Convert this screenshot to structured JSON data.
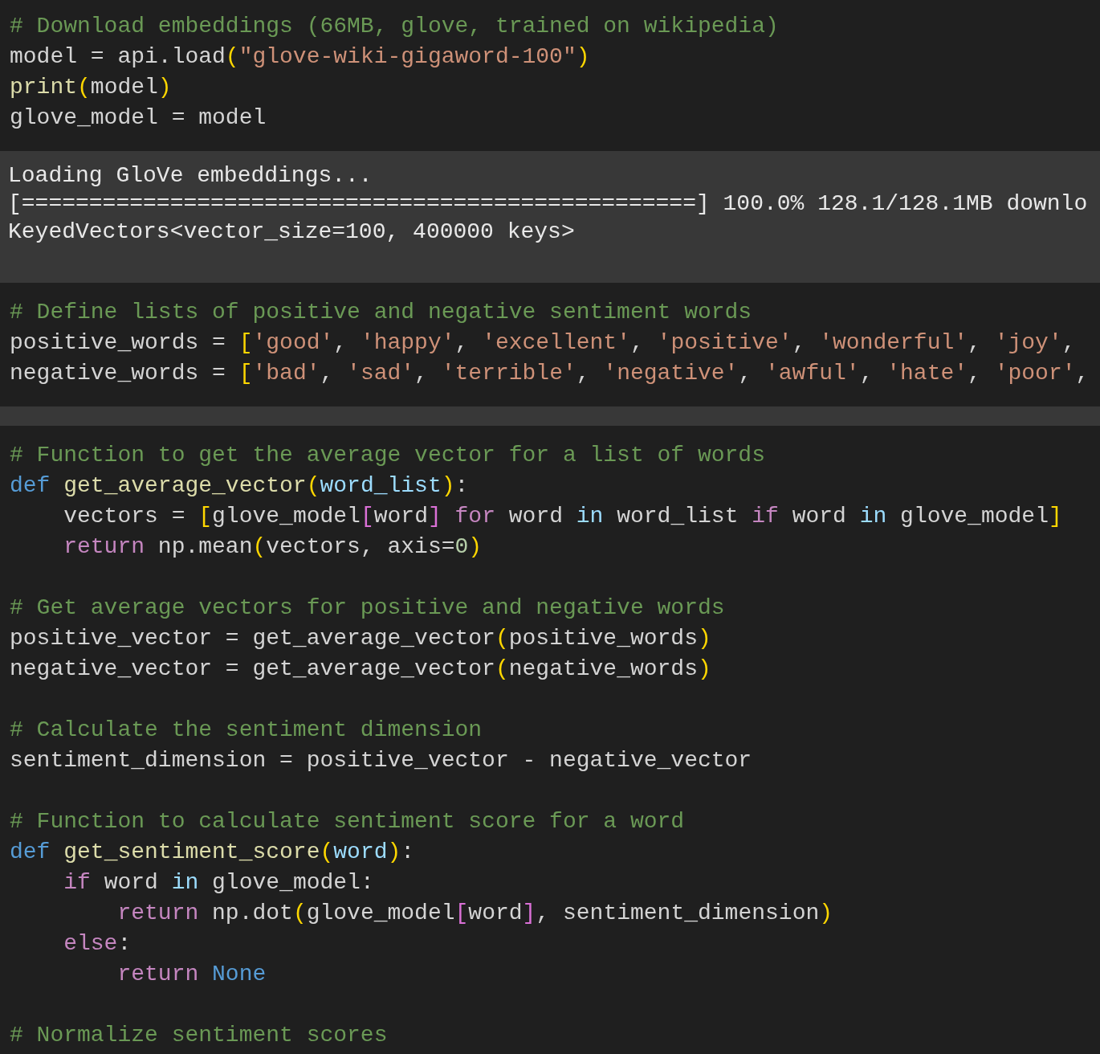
{
  "cells": [
    {
      "kind": "code",
      "blocks": [
        [
          [
            {
              "kind": "comment",
              "text": "# Download embeddings (66MB, glove, trained on wikipedia)"
            }
          ],
          [
            {
              "kind": "plain",
              "text": "model = api.load"
            },
            {
              "kind": "bracket",
              "text": "("
            },
            {
              "kind": "string",
              "text": "\"glove-wiki-gigaword-100\""
            },
            {
              "kind": "bracket",
              "text": ")"
            }
          ],
          [
            {
              "kind": "function",
              "text": "print"
            },
            {
              "kind": "bracket",
              "text": "("
            },
            {
              "kind": "plain",
              "text": "model"
            },
            {
              "kind": "bracket",
              "text": ")"
            }
          ],
          [
            {
              "kind": "plain",
              "text": "glove_model = model"
            }
          ]
        ]
      ]
    },
    {
      "kind": "output",
      "lines": [
        "Loading GloVe embeddings...",
        "[==================================================] 100.0% 128.1/128.1MB downlo",
        "KeyedVectors<vector_size=100, 400000 keys>"
      ]
    },
    {
      "kind": "code",
      "blocks": [
        [
          [
            {
              "kind": "comment",
              "text": "# Define lists of positive and negative sentiment words"
            }
          ],
          [
            {
              "kind": "plain",
              "text": "positive_words = "
            },
            {
              "kind": "bracket",
              "text": "["
            },
            {
              "kind": "string",
              "text": "'good'"
            },
            {
              "kind": "plain",
              "text": ", "
            },
            {
              "kind": "string",
              "text": "'happy'"
            },
            {
              "kind": "plain",
              "text": ", "
            },
            {
              "kind": "string",
              "text": "'excellent'"
            },
            {
              "kind": "plain",
              "text": ", "
            },
            {
              "kind": "string",
              "text": "'positive'"
            },
            {
              "kind": "plain",
              "text": ", "
            },
            {
              "kind": "string",
              "text": "'wonderful'"
            },
            {
              "kind": "plain",
              "text": ", "
            },
            {
              "kind": "string",
              "text": "'joy'"
            },
            {
              "kind": "plain",
              "text": ","
            }
          ],
          [
            {
              "kind": "plain",
              "text": "negative_words = "
            },
            {
              "kind": "bracket",
              "text": "["
            },
            {
              "kind": "string",
              "text": "'bad'"
            },
            {
              "kind": "plain",
              "text": ", "
            },
            {
              "kind": "string",
              "text": "'sad'"
            },
            {
              "kind": "plain",
              "text": ", "
            },
            {
              "kind": "string",
              "text": "'terrible'"
            },
            {
              "kind": "plain",
              "text": ", "
            },
            {
              "kind": "string",
              "text": "'negative'"
            },
            {
              "kind": "plain",
              "text": ", "
            },
            {
              "kind": "string",
              "text": "'awful'"
            },
            {
              "kind": "plain",
              "text": ", "
            },
            {
              "kind": "string",
              "text": "'hate'"
            },
            {
              "kind": "plain",
              "text": ", "
            },
            {
              "kind": "string",
              "text": "'poor'"
            },
            {
              "kind": "plain",
              "text": ","
            }
          ]
        ]
      ]
    },
    {
      "kind": "code",
      "blocks": [
        [
          [
            {
              "kind": "comment",
              "text": "# Function to get the average vector for a list of words"
            }
          ],
          [
            {
              "kind": "storage",
              "text": "def "
            },
            {
              "kind": "function",
              "text": "get_average_vector"
            },
            {
              "kind": "bracket",
              "text": "("
            },
            {
              "kind": "parameter",
              "text": "word_list"
            },
            {
              "kind": "bracket",
              "text": ")"
            },
            {
              "kind": "plain",
              "text": ":"
            }
          ],
          [
            {
              "kind": "plain",
              "text": "    vectors = "
            },
            {
              "kind": "bracket",
              "text": "["
            },
            {
              "kind": "plain",
              "text": "glove_model"
            },
            {
              "kind": "inner",
              "text": "["
            },
            {
              "kind": "plain",
              "text": "word"
            },
            {
              "kind": "inner",
              "text": "]"
            },
            {
              "kind": "control",
              "text": " for"
            },
            {
              "kind": "plain",
              "text": " word "
            },
            {
              "kind": "parameter",
              "text": "in"
            },
            {
              "kind": "plain",
              "text": " word_list "
            },
            {
              "kind": "control",
              "text": "if"
            },
            {
              "kind": "plain",
              "text": " word "
            },
            {
              "kind": "parameter",
              "text": "in"
            },
            {
              "kind": "plain",
              "text": " glove_model"
            },
            {
              "kind": "bracket",
              "text": "]"
            }
          ],
          [
            {
              "kind": "control",
              "text": "    return"
            },
            {
              "kind": "plain",
              "text": " np.mean"
            },
            {
              "kind": "bracket",
              "text": "("
            },
            {
              "kind": "plain",
              "text": "vectors, axis="
            },
            {
              "kind": "number",
              "text": "0"
            },
            {
              "kind": "bracket",
              "text": ")"
            }
          ]
        ],
        [
          [
            {
              "kind": "comment",
              "text": "# Get average vectors for positive and negative words"
            }
          ],
          [
            {
              "kind": "plain",
              "text": "positive_vector = get_average_vector"
            },
            {
              "kind": "bracket",
              "text": "("
            },
            {
              "kind": "plain",
              "text": "positive_words"
            },
            {
              "kind": "bracket",
              "text": ")"
            }
          ],
          [
            {
              "kind": "plain",
              "text": "negative_vector = get_average_vector"
            },
            {
              "kind": "bracket",
              "text": "("
            },
            {
              "kind": "plain",
              "text": "negative_words"
            },
            {
              "kind": "bracket",
              "text": ")"
            }
          ]
        ],
        [
          [
            {
              "kind": "comment",
              "text": "# Calculate the sentiment dimension"
            }
          ],
          [
            {
              "kind": "plain",
              "text": "sentiment_dimension = positive_vector - negative_vector"
            }
          ]
        ],
        [
          [
            {
              "kind": "comment",
              "text": "# Function to calculate sentiment score for a word"
            }
          ],
          [
            {
              "kind": "storage",
              "text": "def "
            },
            {
              "kind": "function",
              "text": "get_sentiment_score"
            },
            {
              "kind": "bracket",
              "text": "("
            },
            {
              "kind": "parameter",
              "text": "word"
            },
            {
              "kind": "bracket",
              "text": ")"
            },
            {
              "kind": "plain",
              "text": ":"
            }
          ],
          [
            {
              "kind": "control",
              "text": "    if"
            },
            {
              "kind": "plain",
              "text": " word "
            },
            {
              "kind": "parameter",
              "text": "in"
            },
            {
              "kind": "plain",
              "text": " glove_model:"
            }
          ],
          [
            {
              "kind": "control",
              "text": "        return"
            },
            {
              "kind": "plain",
              "text": " np.dot"
            },
            {
              "kind": "bracket",
              "text": "("
            },
            {
              "kind": "plain",
              "text": "glove_model"
            },
            {
              "kind": "inner",
              "text": "["
            },
            {
              "kind": "plain",
              "text": "word"
            },
            {
              "kind": "inner",
              "text": "]"
            },
            {
              "kind": "plain",
              "text": ", sentiment_dimension"
            },
            {
              "kind": "bracket",
              "text": ")"
            }
          ],
          [
            {
              "kind": "control",
              "text": "    else"
            },
            {
              "kind": "plain",
              "text": ":"
            }
          ],
          [
            {
              "kind": "control",
              "text": "        return "
            },
            {
              "kind": "storage",
              "text": "None"
            }
          ]
        ],
        [
          [
            {
              "kind": "comment",
              "text": "# Normalize sentiment scores"
            }
          ]
        ]
      ]
    }
  ]
}
